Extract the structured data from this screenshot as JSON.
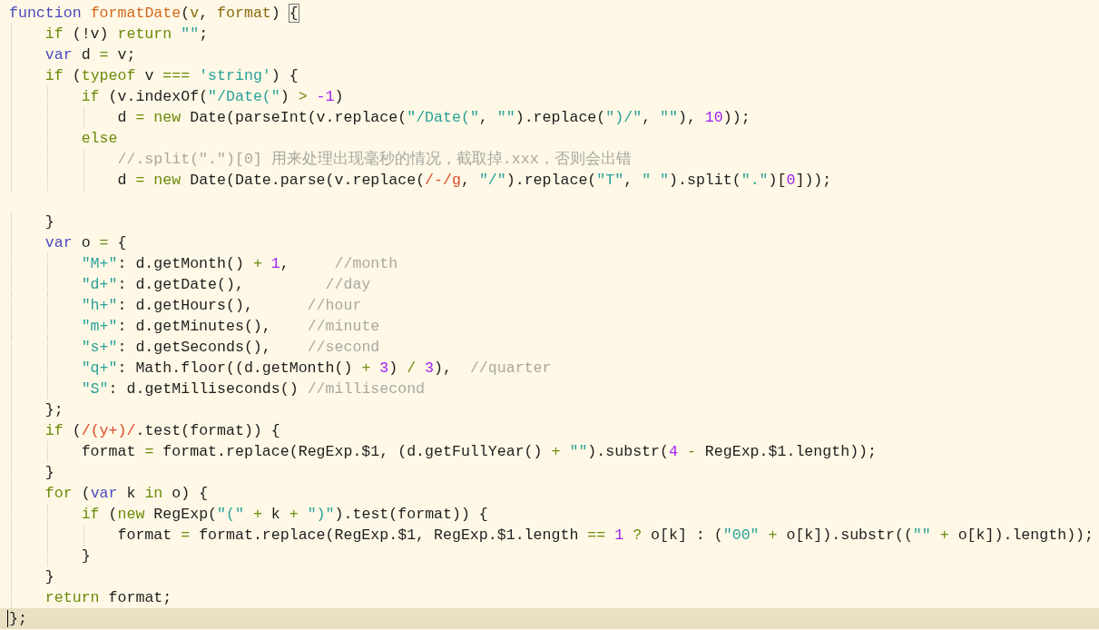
{
  "editor": {
    "lines": [
      {
        "current": false,
        "tokens": [
          {
            "kind": "keyword",
            "text": "function"
          },
          {
            "kind": "function",
            "text": " formatDate"
          },
          {
            "kind": "plain",
            "text": "("
          },
          {
            "kind": "param",
            "text": "v"
          },
          {
            "kind": "plain",
            "text": ", "
          },
          {
            "kind": "param",
            "text": "format"
          },
          {
            "kind": "plain",
            "text": ") "
          },
          {
            "kind": "brace-match",
            "text": "{"
          }
        ]
      },
      {
        "current": false,
        "tokens": [
          {
            "kind": "control",
            "text": "    if"
          },
          {
            "kind": "plain",
            "text": " (!v) "
          },
          {
            "kind": "control",
            "text": "return"
          },
          {
            "kind": "string",
            "text": " \"\""
          },
          {
            "kind": "plain",
            "text": ";"
          }
        ]
      },
      {
        "current": false,
        "tokens": [
          {
            "kind": "keyword",
            "text": "    var"
          },
          {
            "kind": "plain",
            "text": " d "
          },
          {
            "kind": "operator",
            "text": "="
          },
          {
            "kind": "plain",
            "text": " v;"
          }
        ]
      },
      {
        "current": false,
        "tokens": [
          {
            "kind": "control",
            "text": "    if"
          },
          {
            "kind": "plain",
            "text": " ("
          },
          {
            "kind": "control",
            "text": "typeof"
          },
          {
            "kind": "plain",
            "text": " v "
          },
          {
            "kind": "operator",
            "text": "==="
          },
          {
            "kind": "string",
            "text": " 'string'"
          },
          {
            "kind": "plain",
            "text": ") {"
          }
        ]
      },
      {
        "current": false,
        "tokens": [
          {
            "kind": "control",
            "text": "        if"
          },
          {
            "kind": "plain",
            "text": " (v.indexOf("
          },
          {
            "kind": "string",
            "text": "\"/Date(\""
          },
          {
            "kind": "plain",
            "text": ") "
          },
          {
            "kind": "operator",
            "text": ">"
          },
          {
            "kind": "number",
            "text": " -1"
          },
          {
            "kind": "plain",
            "text": ")"
          }
        ]
      },
      {
        "current": false,
        "tokens": [
          {
            "kind": "plain",
            "text": "            d "
          },
          {
            "kind": "operator",
            "text": "="
          },
          {
            "kind": "control",
            "text": " new"
          },
          {
            "kind": "plain",
            "text": " Date(parseInt(v.replace("
          },
          {
            "kind": "string",
            "text": "\"/Date(\""
          },
          {
            "kind": "plain",
            "text": ", "
          },
          {
            "kind": "string",
            "text": "\"\""
          },
          {
            "kind": "plain",
            "text": ").replace("
          },
          {
            "kind": "string",
            "text": "\")/\""
          },
          {
            "kind": "plain",
            "text": ", "
          },
          {
            "kind": "string",
            "text": "\"\""
          },
          {
            "kind": "plain",
            "text": "), "
          },
          {
            "kind": "number",
            "text": "10"
          },
          {
            "kind": "plain",
            "text": "));"
          }
        ]
      },
      {
        "current": false,
        "tokens": [
          {
            "kind": "control",
            "text": "        else"
          }
        ]
      },
      {
        "current": false,
        "tokens": [
          {
            "kind": "comment",
            "text": "            //.split(\".\")[0] 用来处理出现毫秒的情况，截取掉.xxx，否则会出错"
          }
        ]
      },
      {
        "current": false,
        "tokens": [
          {
            "kind": "plain",
            "text": "            d "
          },
          {
            "kind": "operator",
            "text": "="
          },
          {
            "kind": "control",
            "text": " new"
          },
          {
            "kind": "plain",
            "text": " Date(Date.parse(v.replace("
          },
          {
            "kind": "regex",
            "text": "/-/g"
          },
          {
            "kind": "plain",
            "text": ", "
          },
          {
            "kind": "string",
            "text": "\"/\""
          },
          {
            "kind": "plain",
            "text": ").replace("
          },
          {
            "kind": "string",
            "text": "\"T\""
          },
          {
            "kind": "plain",
            "text": ", "
          },
          {
            "kind": "string",
            "text": "\" \""
          },
          {
            "kind": "plain",
            "text": ").split("
          },
          {
            "kind": "string",
            "text": "\".\""
          },
          {
            "kind": "plain",
            "text": ")["
          },
          {
            "kind": "number",
            "text": "0"
          },
          {
            "kind": "plain",
            "text": "]));"
          }
        ]
      },
      {
        "current": false
      },
      {
        "current": false,
        "tokens": [
          {
            "kind": "plain",
            "text": "    }"
          }
        ]
      },
      {
        "current": false,
        "tokens": [
          {
            "kind": "keyword",
            "text": "    var"
          },
          {
            "kind": "plain",
            "text": " o "
          },
          {
            "kind": "operator",
            "text": "="
          },
          {
            "kind": "plain",
            "text": " {"
          }
        ]
      },
      {
        "current": false,
        "tokens": [
          {
            "kind": "string",
            "text": "        \"M+\""
          },
          {
            "kind": "plain",
            "text": ": d.getMonth() "
          },
          {
            "kind": "operator",
            "text": "+"
          },
          {
            "kind": "number",
            "text": " 1"
          },
          {
            "kind": "plain",
            "text": ","
          },
          {
            "kind": "comment",
            "text": "     //month"
          }
        ]
      },
      {
        "current": false,
        "tokens": [
          {
            "kind": "string",
            "text": "        \"d+\""
          },
          {
            "kind": "plain",
            "text": ": d.getDate(),"
          },
          {
            "kind": "comment",
            "text": "         //day"
          }
        ]
      },
      {
        "current": false,
        "tokens": [
          {
            "kind": "string",
            "text": "        \"h+\""
          },
          {
            "kind": "plain",
            "text": ": d.getHours(),"
          },
          {
            "kind": "comment",
            "text": "      //hour"
          }
        ]
      },
      {
        "current": false,
        "tokens": [
          {
            "kind": "string",
            "text": "        \"m+\""
          },
          {
            "kind": "plain",
            "text": ": d.getMinutes(),"
          },
          {
            "kind": "comment",
            "text": "    //minute"
          }
        ]
      },
      {
        "current": false,
        "tokens": [
          {
            "kind": "string",
            "text": "        \"s+\""
          },
          {
            "kind": "plain",
            "text": ": d.getSeconds(),"
          },
          {
            "kind": "comment",
            "text": "    //second"
          }
        ]
      },
      {
        "current": false,
        "tokens": [
          {
            "kind": "string",
            "text": "        \"q+\""
          },
          {
            "kind": "plain",
            "text": ": Math.floor((d.getMonth() "
          },
          {
            "kind": "operator",
            "text": "+"
          },
          {
            "kind": "number",
            "text": " 3"
          },
          {
            "kind": "plain",
            "text": ") "
          },
          {
            "kind": "operator",
            "text": "/"
          },
          {
            "kind": "number",
            "text": " 3"
          },
          {
            "kind": "plain",
            "text": "),"
          },
          {
            "kind": "comment",
            "text": "  //quarter"
          }
        ]
      },
      {
        "current": false,
        "tokens": [
          {
            "kind": "string",
            "text": "        \"S\""
          },
          {
            "kind": "plain",
            "text": ": d.getMilliseconds()"
          },
          {
            "kind": "comment",
            "text": " //millisecond"
          }
        ]
      },
      {
        "current": false,
        "tokens": [
          {
            "kind": "plain",
            "text": "    };"
          }
        ]
      },
      {
        "current": false,
        "tokens": [
          {
            "kind": "control",
            "text": "    if"
          },
          {
            "kind": "plain",
            "text": " ("
          },
          {
            "kind": "regex",
            "text": "/(y+)/"
          },
          {
            "kind": "plain",
            "text": ".test(format)) {"
          }
        ]
      },
      {
        "current": false,
        "tokens": [
          {
            "kind": "plain",
            "text": "        format "
          },
          {
            "kind": "operator",
            "text": "="
          },
          {
            "kind": "plain",
            "text": " format.replace(RegExp.$1, (d.getFullYear() "
          },
          {
            "kind": "operator",
            "text": "+"
          },
          {
            "kind": "string",
            "text": " \"\""
          },
          {
            "kind": "plain",
            "text": ").substr("
          },
          {
            "kind": "number",
            "text": "4"
          },
          {
            "kind": "operator",
            "text": " -"
          },
          {
            "kind": "plain",
            "text": " RegExp.$1.length));"
          }
        ]
      },
      {
        "current": false,
        "tokens": [
          {
            "kind": "plain",
            "text": "    }"
          }
        ]
      },
      {
        "current": false,
        "tokens": [
          {
            "kind": "control",
            "text": "    for"
          },
          {
            "kind": "plain",
            "text": " ("
          },
          {
            "kind": "keyword",
            "text": "var"
          },
          {
            "kind": "plain",
            "text": " k "
          },
          {
            "kind": "control",
            "text": "in"
          },
          {
            "kind": "plain",
            "text": " o) {"
          }
        ]
      },
      {
        "current": false,
        "tokens": [
          {
            "kind": "control",
            "text": "        if"
          },
          {
            "kind": "plain",
            "text": " ("
          },
          {
            "kind": "control",
            "text": "new"
          },
          {
            "kind": "plain",
            "text": " RegExp("
          },
          {
            "kind": "string",
            "text": "\"(\""
          },
          {
            "kind": "operator",
            "text": " +"
          },
          {
            "kind": "plain",
            "text": " k "
          },
          {
            "kind": "operator",
            "text": "+"
          },
          {
            "kind": "string",
            "text": " \")\""
          },
          {
            "kind": "plain",
            "text": ").test(format)) {"
          }
        ]
      },
      {
        "current": false,
        "tokens": [
          {
            "kind": "plain",
            "text": "            format "
          },
          {
            "kind": "operator",
            "text": "="
          },
          {
            "kind": "plain",
            "text": " format.replace(RegExp.$1, RegExp.$1.length "
          },
          {
            "kind": "operator",
            "text": "=="
          },
          {
            "kind": "number",
            "text": " 1"
          },
          {
            "kind": "operator",
            "text": " ?"
          },
          {
            "kind": "plain",
            "text": " o[k] : ("
          },
          {
            "kind": "string",
            "text": "\"00\""
          },
          {
            "kind": "operator",
            "text": " +"
          },
          {
            "kind": "plain",
            "text": " o[k]).substr(("
          },
          {
            "kind": "string",
            "text": "\"\""
          },
          {
            "kind": "operator",
            "text": " +"
          },
          {
            "kind": "plain",
            "text": " o[k]).length));"
          }
        ]
      },
      {
        "current": false,
        "tokens": [
          {
            "kind": "plain",
            "text": "        }"
          }
        ]
      },
      {
        "current": false,
        "tokens": [
          {
            "kind": "plain",
            "text": "    }"
          }
        ]
      },
      {
        "current": false,
        "tokens": [
          {
            "kind": "control",
            "text": "    return"
          },
          {
            "kind": "plain",
            "text": " format;"
          }
        ]
      },
      {
        "current": true,
        "tokens": [
          {
            "kind": "plain",
            "text": "};"
          }
        ]
      }
    ]
  }
}
